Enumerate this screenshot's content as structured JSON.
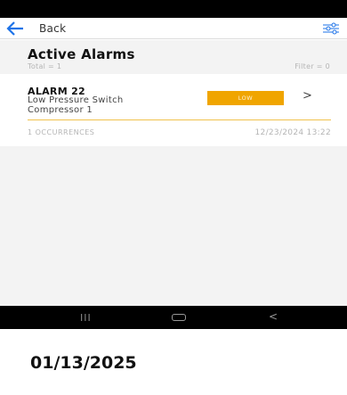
{
  "nav": {
    "back_label": "Back",
    "back_icon": "arrow-left-icon",
    "filter_icon": "sliders-icon"
  },
  "colors": {
    "accent": "#1e73e8",
    "badge": "#f0a500",
    "divider": "#f0c24d"
  },
  "header": {
    "title": "Active Alarms",
    "total": "Total = 1",
    "filter": "Filter = 0"
  },
  "alarm": {
    "name": "ALARM 22",
    "desc1": "Low Pressure Switch",
    "desc2": "Compressor 1",
    "severity": "LOW",
    "chevron": ">",
    "occurrences": "1 OCCURRENCES",
    "timestamp": "12/23/2024 13:22"
  },
  "android_nav": {
    "recent": "III",
    "back": "<"
  },
  "caption": {
    "date": "01/13/2025"
  }
}
